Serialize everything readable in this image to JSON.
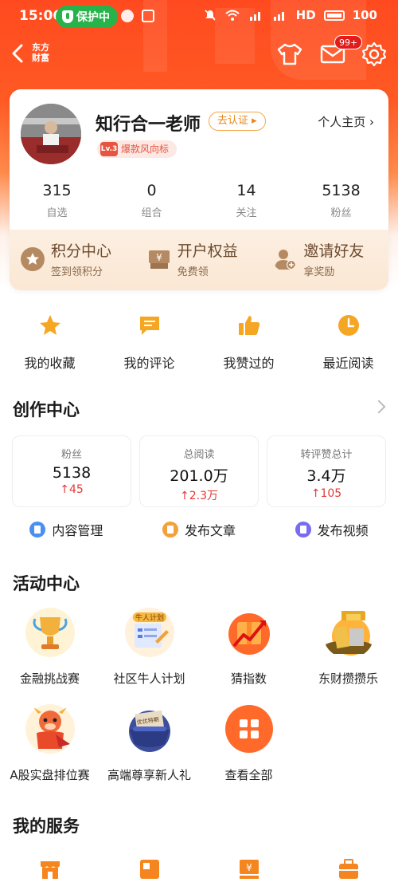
{
  "status_bar": {
    "time": "15:06",
    "protect_label": "保护中",
    "network": "HD",
    "battery": "100"
  },
  "nav": {
    "logo_text": "东方财富",
    "mail_badge": "99+"
  },
  "profile": {
    "name": "知行合一老师",
    "verify_label": "去认证 ▸",
    "homepage_label": "个人主页 ›",
    "level": "Lv.3",
    "tag": "爆款风向标",
    "stats": [
      {
        "value": "315",
        "label": "自选"
      },
      {
        "value": "0",
        "label": "组合"
      },
      {
        "value": "14",
        "label": "关注"
      },
      {
        "value": "5138",
        "label": "粉丝"
      }
    ],
    "promos": [
      {
        "title": "积分中心",
        "sub": "签到领积分",
        "icon": "star-coin-icon"
      },
      {
        "title": "开户权益",
        "sub": "免费领",
        "icon": "yuan-box-icon"
      },
      {
        "title": "邀请好友",
        "sub": "拿奖励",
        "icon": "add-user-icon"
      }
    ]
  },
  "quick_links": [
    {
      "label": "我的收藏",
      "icon": "star-icon"
    },
    {
      "label": "我的评论",
      "icon": "comment-icon"
    },
    {
      "label": "我赞过的",
      "icon": "thumbs-up-icon"
    },
    {
      "label": "最近阅读",
      "icon": "clock-icon"
    }
  ],
  "creation_center": {
    "title": "创作中心",
    "metrics": [
      {
        "label": "粉丝",
        "value": "5138",
        "delta": "↑45"
      },
      {
        "label": "总阅读",
        "value": "201.0万",
        "delta": "↑2.3万"
      },
      {
        "label": "转评赞总计",
        "value": "3.4万",
        "delta": "↑105"
      }
    ],
    "actions": [
      {
        "label": "内容管理",
        "color": "#4a8ff5"
      },
      {
        "label": "发布文章",
        "color": "#f2a23a"
      },
      {
        "label": "发布视频",
        "color": "#7a6cf0"
      }
    ]
  },
  "activity_center": {
    "title": "活动中心",
    "items": [
      {
        "label": "金融挑战赛",
        "icon": "trophy-icon"
      },
      {
        "label": "社区牛人计划",
        "icon": "bull-plan-icon",
        "icon_text": "牛人计划"
      },
      {
        "label": "猜指数",
        "icon": "gift-chart-icon"
      },
      {
        "label": "东财攒攒乐",
        "icon": "gold-bars-icon"
      },
      {
        "label": "A股实盘排位赛",
        "icon": "bull-mascot-icon"
      },
      {
        "label": "高端尊享新人礼",
        "icon": "gift-box-icon",
        "icon_text": "优优特期"
      },
      {
        "label": "查看全部",
        "icon": "grid-icon"
      }
    ]
  },
  "services": {
    "title": "我的服务",
    "icons": [
      "store-icon",
      "layout-icon",
      "yuan-doc-icon",
      "briefcase-icon"
    ]
  },
  "colors": {
    "brand": "#ff4a1f",
    "accent": "#f5861f",
    "up": "#e53935"
  }
}
